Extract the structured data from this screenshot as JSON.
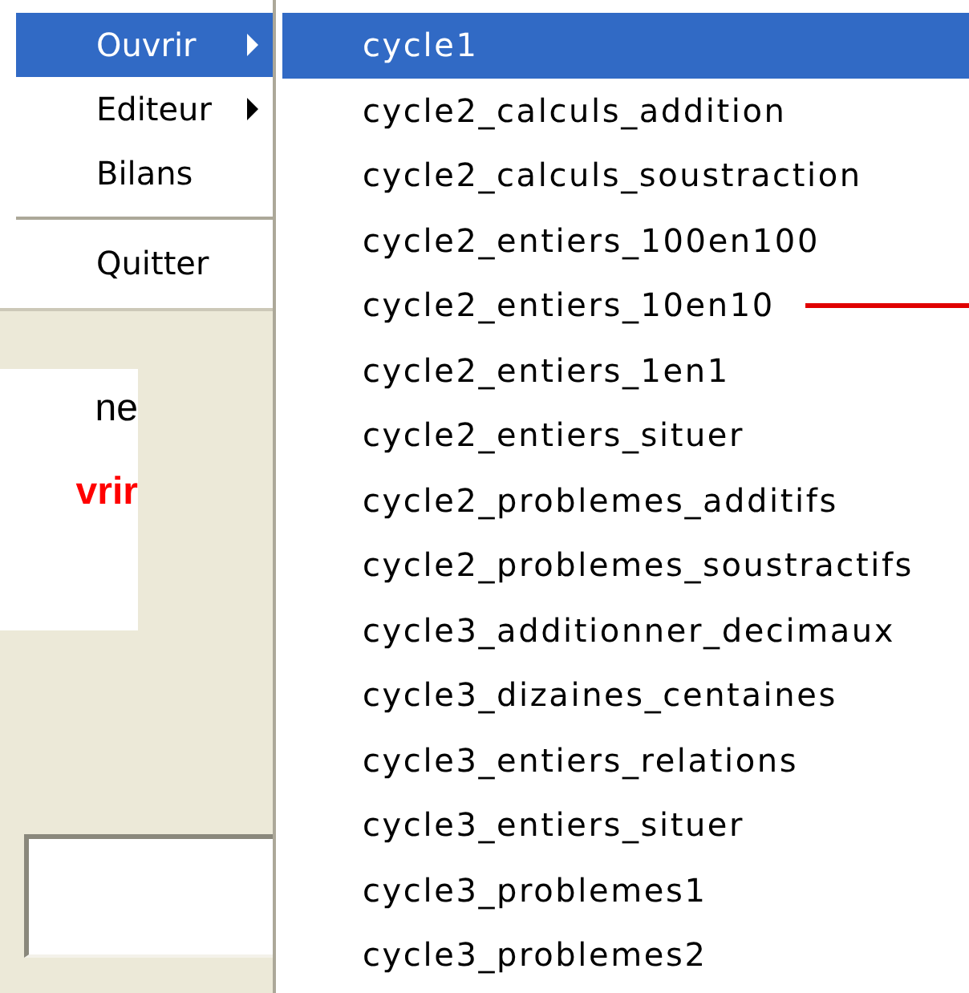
{
  "menu": {
    "items": [
      {
        "label": "Ouvrir",
        "kind": "submenu",
        "selected": true
      },
      {
        "label": "Editeur",
        "kind": "submenu",
        "selected": false
      },
      {
        "label": "Bilans",
        "kind": "item",
        "selected": false
      },
      {
        "kind": "separator"
      },
      {
        "label": "Quitter",
        "kind": "item",
        "selected": false
      }
    ]
  },
  "panel": {
    "lines": [
      {
        "text": "ne",
        "kind": "plain"
      },
      {
        "text": "vrir",
        "kind": "highlight"
      }
    ]
  },
  "submenu": {
    "items": [
      {
        "label": "cycle1",
        "selected": true
      },
      {
        "label": "cycle2_calculs_addition",
        "selected": false
      },
      {
        "label": "cycle2_calculs_soustraction",
        "selected": false
      },
      {
        "label": "cycle2_entiers_100en100",
        "selected": false
      },
      {
        "label": "cycle2_entiers_10en10",
        "selected": false,
        "pointer": true
      },
      {
        "label": "cycle2_entiers_1en1",
        "selected": false
      },
      {
        "label": "cycle2_entiers_situer",
        "selected": false
      },
      {
        "label": "cycle2_problemes_additifs",
        "selected": false
      },
      {
        "label": "cycle2_problemes_soustractifs",
        "selected": false
      },
      {
        "label": "cycle3_additionner_decimaux",
        "selected": false
      },
      {
        "label": "cycle3_dizaines_centaines",
        "selected": false
      },
      {
        "label": "cycle3_entiers_relations",
        "selected": false
      },
      {
        "label": "cycle3_entiers_situer",
        "selected": false
      },
      {
        "label": "cycle3_problemes1",
        "selected": false
      },
      {
        "label": "cycle3_problemes2",
        "selected": false
      }
    ]
  }
}
